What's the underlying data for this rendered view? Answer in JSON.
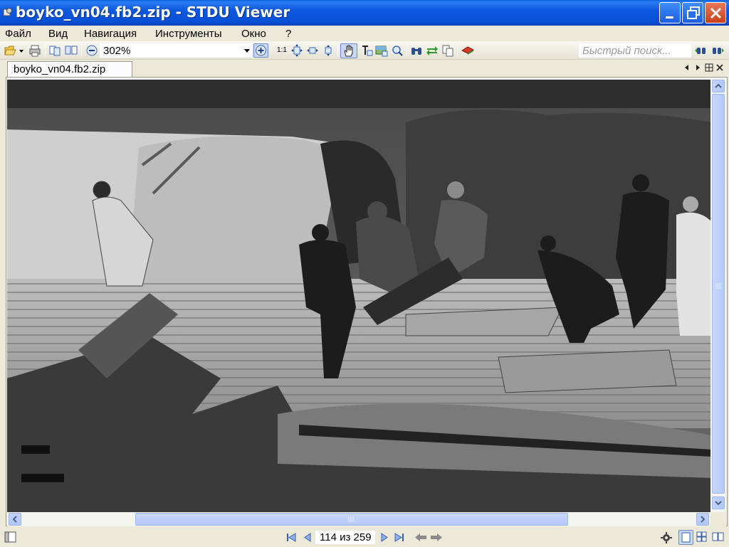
{
  "window": {
    "title": "boyko_vn04.fb2.zip - STDU Viewer"
  },
  "menu": {
    "items": [
      "Файл",
      "Вид",
      "Навигация",
      "Инструменты",
      "Окно",
      "?"
    ]
  },
  "toolbar": {
    "zoom_value": "302%",
    "one_to_one_label": "1:1",
    "search_placeholder": "Быстрый поиск..."
  },
  "tabs": {
    "active_label": "boyko_vn04.fb2.zip"
  },
  "status": {
    "page_indicator": "114 из 259"
  },
  "colors": {
    "titlebar": "#0a50d6",
    "chrome": "#ece9d8",
    "scroll_accent": "#b6c9fb"
  }
}
